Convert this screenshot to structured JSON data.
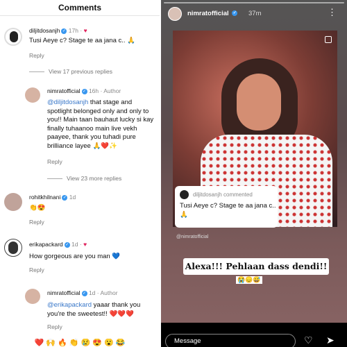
{
  "comments_panel": {
    "title": "Comments",
    "comments": [
      {
        "user": "diljitdosanjh",
        "meta": "17h",
        "text": "Tusi Aeye c? Stage te aa jana c.. 🙏",
        "reply": "Reply",
        "liked_by_author": true
      },
      {
        "view_more": "View 17 previous replies"
      },
      {
        "user": "nimratofficial",
        "meta": "16h · Author",
        "mention": "@diljitdosanjh",
        "text": " that stage and spotlight belonged only and only to you!! Main taan bauhaut lucky si kay finally tuhaanoo main live vekh paayee, thank you tuhadi pure brilliance layee 🙏❤️✨",
        "reply": "Reply"
      },
      {
        "view_more": "View 23 more replies"
      },
      {
        "user": "rohitkhilnani",
        "meta": "1d",
        "text": "👏😍",
        "reply": "Reply"
      },
      {
        "user": "erikapackard",
        "meta": "1d",
        "text": "How gorgeous are you man 💙",
        "reply": "Reply",
        "liked_by_author": true
      },
      {
        "user": "nimratofficial",
        "meta": "1d · Author",
        "mention": "@erikapackard",
        "text": " yaaar thank you you're the sweetest!! ❤️❤️❤️",
        "reply": "Reply"
      }
    ],
    "reaction_bar": "❤️ 🙌 🔥 👏 😢 😍 😮 😂"
  },
  "story": {
    "username": "nimratofficial",
    "time": "37m",
    "more_icon": "more-dots-icon",
    "comment_card": {
      "user": "diljitdosanjh commented",
      "text": "Tusi Aeye c? Stage te aa jana c.. 🙏"
    },
    "watermark": "@nimratofficial",
    "sticker_text": "Alexa!!! Pehlaan dass dendi!!",
    "sticker_emojis": "😭😞😅",
    "message_placeholder": "Message",
    "icons": [
      "heart-icon",
      "send-icon"
    ]
  },
  "colors": {
    "accent": "#3897f0",
    "mention": "#3a78c9",
    "heart": "#e0245e"
  }
}
